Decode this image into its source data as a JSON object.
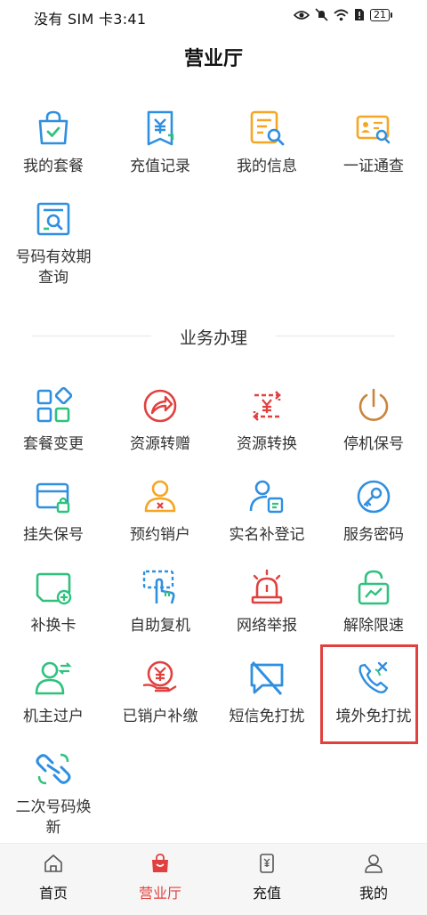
{
  "status_bar": {
    "text": "没有 SIM 卡3:41",
    "battery": "21"
  },
  "header": {
    "title": "营业厅"
  },
  "quick_items": [
    {
      "label": "我的套餐",
      "icon": "shopping-bag-check-icon"
    },
    {
      "label": "充值记录",
      "icon": "yuan-receipt-icon"
    },
    {
      "label": "我的信息",
      "icon": "document-search-icon"
    },
    {
      "label": "一证通查",
      "icon": "id-card-search-icon"
    },
    {
      "label": "号码有效期\n查询",
      "icon": "number-search-icon"
    }
  ],
  "section": {
    "title": "业务办理"
  },
  "services": [
    {
      "label": "套餐变更",
      "icon": "grid-shapes-icon"
    },
    {
      "label": "资源转赠",
      "icon": "share-arrow-icon"
    },
    {
      "label": "资源转换",
      "icon": "yuan-exchange-icon"
    },
    {
      "label": "停机保号",
      "icon": "power-icon"
    },
    {
      "label": "挂失保号",
      "icon": "card-lock-icon"
    },
    {
      "label": "预约销户",
      "icon": "user-cancel-icon"
    },
    {
      "label": "实名补登记",
      "icon": "user-card-icon"
    },
    {
      "label": "服务密码",
      "icon": "key-icon"
    },
    {
      "label": "补换卡",
      "icon": "sim-card-add-icon"
    },
    {
      "label": "自助复机",
      "icon": "touch-hand-icon"
    },
    {
      "label": "网络举报",
      "icon": "alarm-light-icon"
    },
    {
      "label": "解除限速",
      "icon": "unlock-chart-icon"
    },
    {
      "label": "机主过户",
      "icon": "user-transfer-icon"
    },
    {
      "label": "已销户补缴",
      "icon": "yuan-hand-icon"
    },
    {
      "label": "短信免打扰",
      "icon": "message-block-icon"
    },
    {
      "label": "境外免打扰",
      "icon": "phone-block-icon"
    },
    {
      "label": "二次号码焕\n新",
      "icon": "link-refresh-icon"
    }
  ],
  "bottom_nav": [
    {
      "label": "首页",
      "icon": "home-icon"
    },
    {
      "label": "营业厅",
      "icon": "bag-icon",
      "active": true
    },
    {
      "label": "充值",
      "icon": "recharge-icon"
    },
    {
      "label": "我的",
      "icon": "user-icon"
    }
  ],
  "colors": {
    "blue": "#2f8fe0",
    "red": "#e0413f",
    "orange": "#f5a623",
    "green": "#2ec27e",
    "brown": "#c9853a"
  }
}
